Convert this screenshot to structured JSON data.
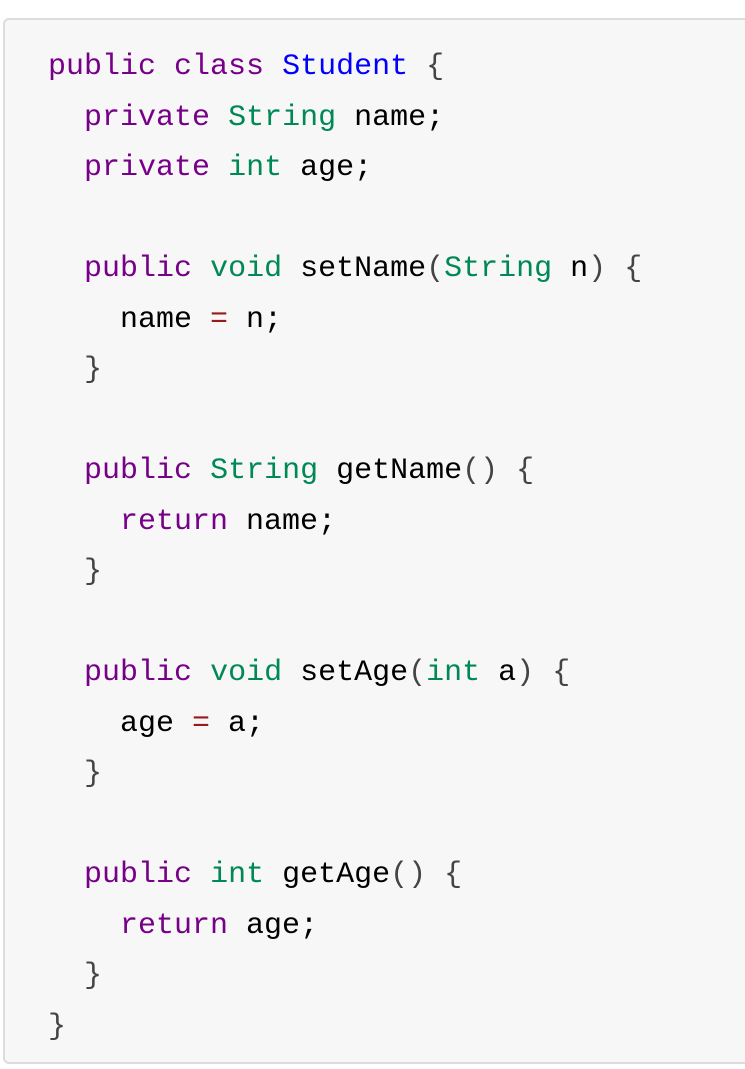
{
  "colors": {
    "keyword": "#770088",
    "type": "#008855",
    "def": "#0000ff",
    "operator": "#981a1a",
    "bracket": "#444444",
    "plain": "#000000",
    "background": "#f7f7f7"
  },
  "code_lines": [
    [
      [
        "public",
        "keyword"
      ],
      [
        " ",
        "plain"
      ],
      [
        "class",
        "keyword"
      ],
      [
        " ",
        "plain"
      ],
      [
        "Student",
        "def"
      ],
      [
        " ",
        "plain"
      ],
      [
        "{",
        "bracket"
      ]
    ],
    [
      [
        "  ",
        "plain"
      ],
      [
        "private",
        "keyword"
      ],
      [
        " ",
        "plain"
      ],
      [
        "String",
        "type"
      ],
      [
        " name;",
        "plain"
      ]
    ],
    [
      [
        "  ",
        "plain"
      ],
      [
        "private",
        "keyword"
      ],
      [
        " ",
        "plain"
      ],
      [
        "int",
        "type"
      ],
      [
        " age;",
        "plain"
      ]
    ],
    [],
    [
      [
        "  ",
        "plain"
      ],
      [
        "public",
        "keyword"
      ],
      [
        " ",
        "plain"
      ],
      [
        "void",
        "type"
      ],
      [
        " setName",
        "plain"
      ],
      [
        "(",
        "bracket"
      ],
      [
        "String",
        "type"
      ],
      [
        " n",
        "plain"
      ],
      [
        ")",
        "bracket"
      ],
      [
        " ",
        "plain"
      ],
      [
        "{",
        "bracket"
      ]
    ],
    [
      [
        "    name ",
        "plain"
      ],
      [
        "=",
        "operator"
      ],
      [
        " n;",
        "plain"
      ]
    ],
    [
      [
        "  ",
        "plain"
      ],
      [
        "}",
        "bracket"
      ]
    ],
    [],
    [
      [
        "  ",
        "plain"
      ],
      [
        "public",
        "keyword"
      ],
      [
        " ",
        "plain"
      ],
      [
        "String",
        "type"
      ],
      [
        " getName",
        "plain"
      ],
      [
        "()",
        "bracket"
      ],
      [
        " ",
        "plain"
      ],
      [
        "{",
        "bracket"
      ]
    ],
    [
      [
        "    ",
        "plain"
      ],
      [
        "return",
        "keyword"
      ],
      [
        " name;",
        "plain"
      ]
    ],
    [
      [
        "  ",
        "plain"
      ],
      [
        "}",
        "bracket"
      ]
    ],
    [],
    [
      [
        "  ",
        "plain"
      ],
      [
        "public",
        "keyword"
      ],
      [
        " ",
        "plain"
      ],
      [
        "void",
        "type"
      ],
      [
        " setAge",
        "plain"
      ],
      [
        "(",
        "bracket"
      ],
      [
        "int",
        "type"
      ],
      [
        " a",
        "plain"
      ],
      [
        ")",
        "bracket"
      ],
      [
        " ",
        "plain"
      ],
      [
        "{",
        "bracket"
      ]
    ],
    [
      [
        "    age ",
        "plain"
      ],
      [
        "=",
        "operator"
      ],
      [
        " a;",
        "plain"
      ]
    ],
    [
      [
        "  ",
        "plain"
      ],
      [
        "}",
        "bracket"
      ]
    ],
    [],
    [
      [
        "  ",
        "plain"
      ],
      [
        "public",
        "keyword"
      ],
      [
        " ",
        "plain"
      ],
      [
        "int",
        "type"
      ],
      [
        " getAge",
        "plain"
      ],
      [
        "()",
        "bracket"
      ],
      [
        " ",
        "plain"
      ],
      [
        "{",
        "bracket"
      ]
    ],
    [
      [
        "    ",
        "plain"
      ],
      [
        "return",
        "keyword"
      ],
      [
        " age;",
        "plain"
      ]
    ],
    [
      [
        "  ",
        "plain"
      ],
      [
        "}",
        "bracket"
      ]
    ],
    [
      [
        "}",
        "bracket"
      ]
    ]
  ]
}
